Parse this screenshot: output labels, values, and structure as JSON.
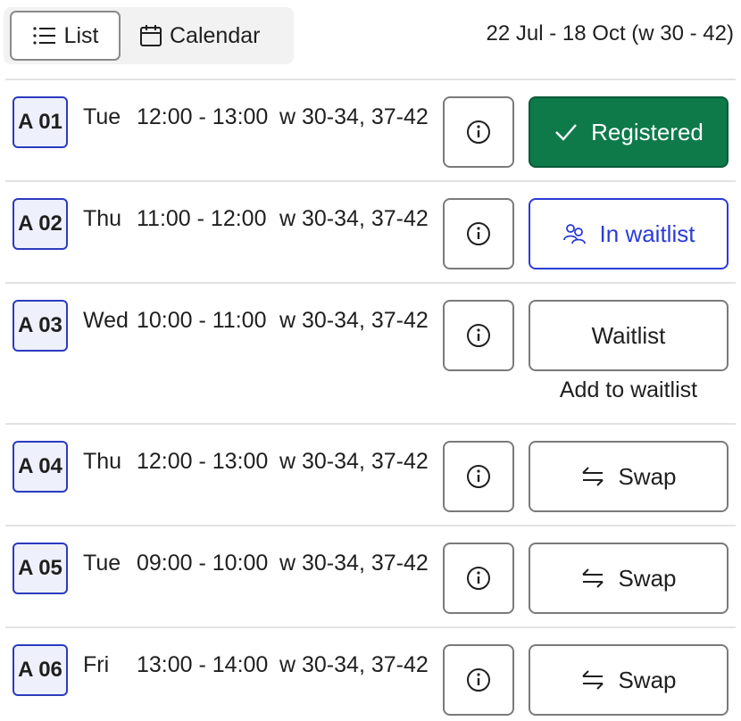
{
  "view_toggle": {
    "list_label": "List",
    "calendar_label": "Calendar"
  },
  "date_range": "22 Jul - 18 Oct (w 30 - 42)",
  "colors": {
    "registered": "#0e7a4a",
    "waitlist_accent": "#2b3bd6",
    "badge_border": "#2b3bbf"
  },
  "rows": [
    {
      "group": "A 01",
      "day": "Tue",
      "time": "12:00 - 13:00",
      "weeks": "w 30-34, 37-42",
      "action": {
        "label": "Registered",
        "icon": "check-icon",
        "state": "registered"
      }
    },
    {
      "group": "A 02",
      "day": "Thu",
      "time": "11:00 - 12:00",
      "weeks": "w 30-34, 37-42",
      "action": {
        "label": "In waitlist",
        "icon": "people-icon",
        "state": "waitlisted"
      }
    },
    {
      "group": "A 03",
      "day": "Wed",
      "time": "10:00 - 11:00",
      "weeks": "w 30-34, 37-42",
      "action": {
        "label": "Waitlist",
        "icon": "",
        "state": "plain"
      },
      "note": "Add to waitlist"
    },
    {
      "group": "A 04",
      "day": "Thu",
      "time": "12:00 - 13:00",
      "weeks": "w 30-34, 37-42",
      "action": {
        "label": "Swap",
        "icon": "swap-icon",
        "state": "plain"
      }
    },
    {
      "group": "A 05",
      "day": "Tue",
      "time": "09:00 - 10:00",
      "weeks": "w 30-34, 37-42",
      "action": {
        "label": "Swap",
        "icon": "swap-icon",
        "state": "plain"
      }
    },
    {
      "group": "A 06",
      "day": "Fri",
      "time": "13:00 - 14:00",
      "weeks": "w 30-34, 37-42",
      "action": {
        "label": "Swap",
        "icon": "swap-icon",
        "state": "plain"
      }
    }
  ]
}
